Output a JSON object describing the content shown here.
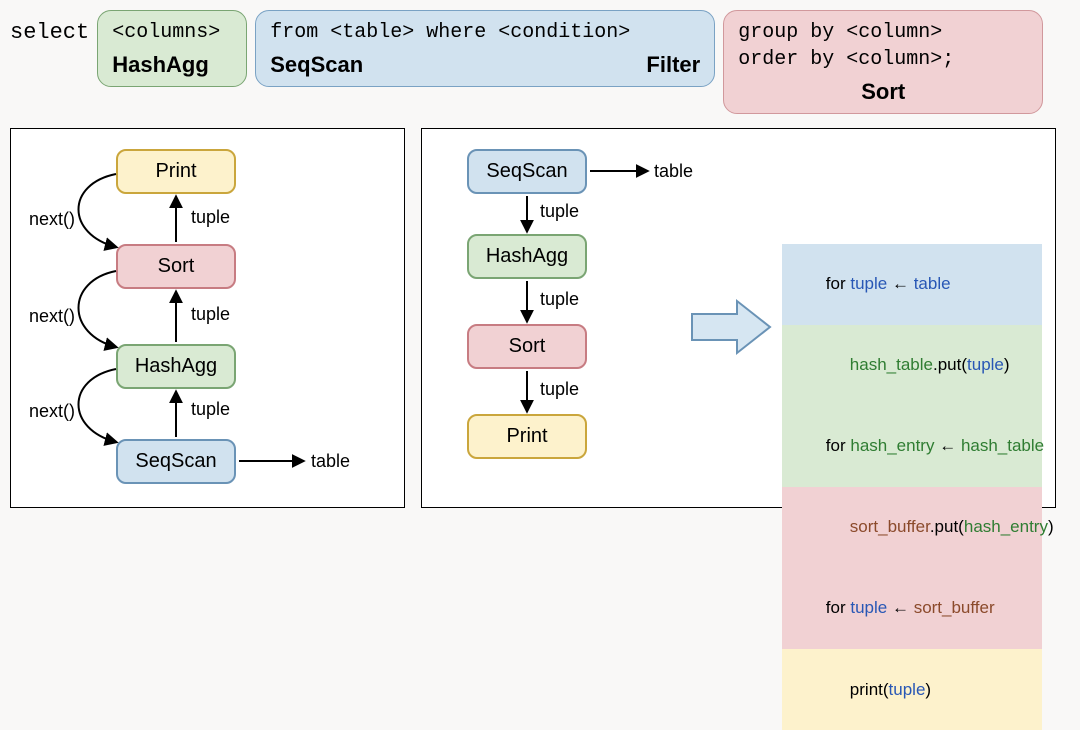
{
  "sql": {
    "select": "select",
    "columns": "<columns>",
    "from_where": "from <table> where <condition>",
    "group_by": "group by <column>",
    "order_by": "order by <column>;",
    "op_hashagg": "HashAgg",
    "op_seqscan": "SeqScan",
    "op_filter": "Filter",
    "op_sort": "Sort"
  },
  "nodes": {
    "print": "Print",
    "sort": "Sort",
    "hashagg": "HashAgg",
    "seqscan": "SeqScan"
  },
  "labels": {
    "next": "next()",
    "tuple": "tuple",
    "table": "table"
  },
  "code": {
    "l1a": "for ",
    "l1b": "tuple",
    "l1c": " ← ",
    "l1d": "table",
    "l2a": "hash_table",
    "l2b": ".put(",
    "l2c": "tuple",
    "l2d": ")",
    "l3a": "for ",
    "l3b": "hash_entry",
    "l3c": " ← ",
    "l3d": "hash_table",
    "l4a": "sort_buffer",
    "l4b": ".put(",
    "l4c": "hash_entry",
    "l4d": ")",
    "l5a": "for ",
    "l5b": "tuple",
    "l5c": " ← ",
    "l5d": "sort_buffer",
    "l6a": "print(",
    "l6b": "tuple",
    "l6c": ")"
  }
}
